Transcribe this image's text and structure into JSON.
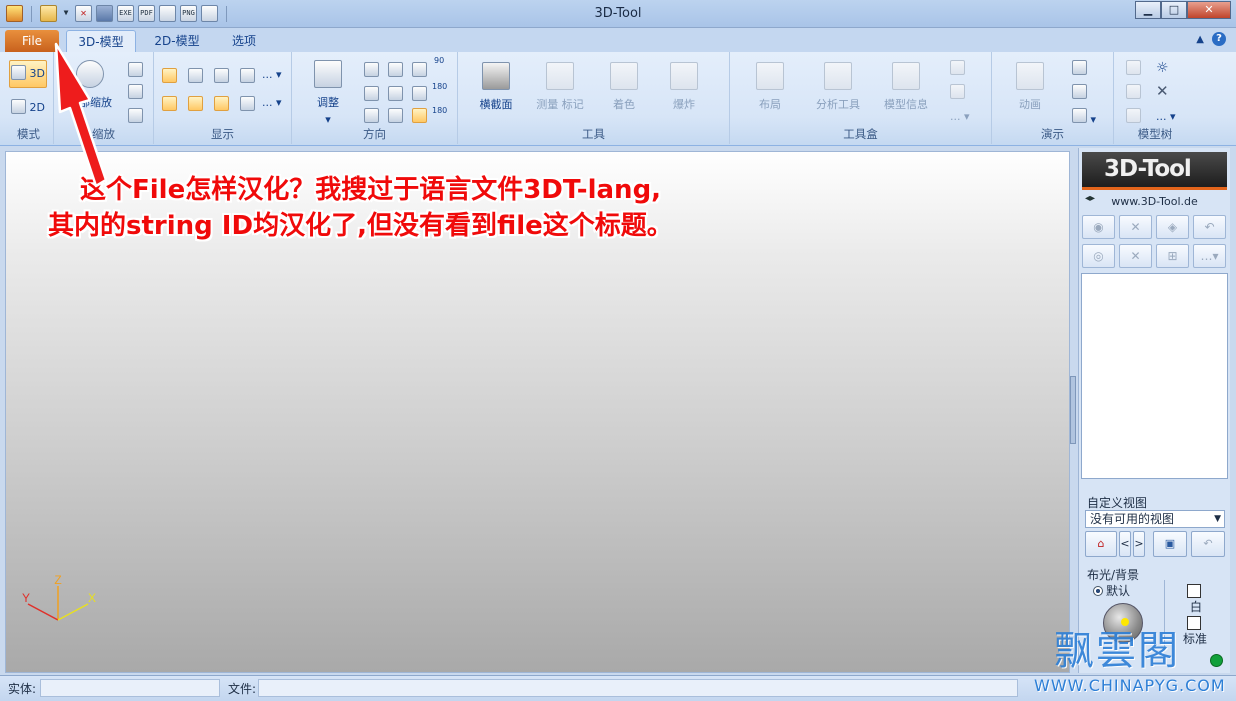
{
  "window": {
    "title": "3D-Tool"
  },
  "quick_access": [
    "app-icon",
    "open-folder-icon",
    "dropdown-icon",
    "close-file-icon",
    "save-icon",
    "exe-icon",
    "pdf-icon",
    "print-icon",
    "png-icon",
    "copy-icon"
  ],
  "quick_access_labels": {
    "exe": "EXE",
    "pdf": "PDF",
    "png": "PNG"
  },
  "tabs": {
    "file": "File",
    "model3d": "3D-模型",
    "model2d": "2D-模型",
    "options": "选项"
  },
  "ribbon": {
    "mode": {
      "label": "模式",
      "b3d": "3D",
      "b2d": "2D"
    },
    "zoom": {
      "label": "缩放",
      "fit": "全部缩放"
    },
    "display": {
      "label": "显示",
      "more": "..."
    },
    "direction": {
      "label": "方向",
      "adjust": "调整",
      "r90": "90",
      "r180a": "180",
      "r180b": "180"
    },
    "tools": {
      "label": "工具",
      "section": "横截面",
      "measure": "测量 标记",
      "color": "着色",
      "explode": "爆炸"
    },
    "toolbox": {
      "label": "工具盒",
      "layout": "布局",
      "analysis": "分析工具",
      "info": "模型信息",
      "more": "..."
    },
    "demo": {
      "label": "演示",
      "animation": "动画"
    },
    "tree": {
      "label": "模型树",
      "more": "..."
    }
  },
  "annotation": {
    "line1": "这个File怎样汉化？我搜过于语言文件3DT-lang,",
    "line2": "其内的string ID均汉化了,但没有看到file这个标题。"
  },
  "panel": {
    "logo": "3D-Tool",
    "url": "www.3D-Tool.de",
    "custom_views_title": "自定义视图",
    "views_select": "没有可用的视图",
    "prev": "<",
    "next": ">",
    "lighting_title": "布光/背景",
    "default_radio": "默认",
    "white_label": "白",
    "standard_label": "标准"
  },
  "axis": {
    "x": "X",
    "y": "Y",
    "z": "Z"
  },
  "statusbar": {
    "entity_label": "实体:",
    "file_label": "文件:"
  },
  "watermark": {
    "cn": "飘雲閣",
    "en": "WWW.CHINAPYG.COM"
  },
  "colors": {
    "file_tab": "#d9702a",
    "annotation": "#f00a0a",
    "accent": "#1e395b"
  }
}
